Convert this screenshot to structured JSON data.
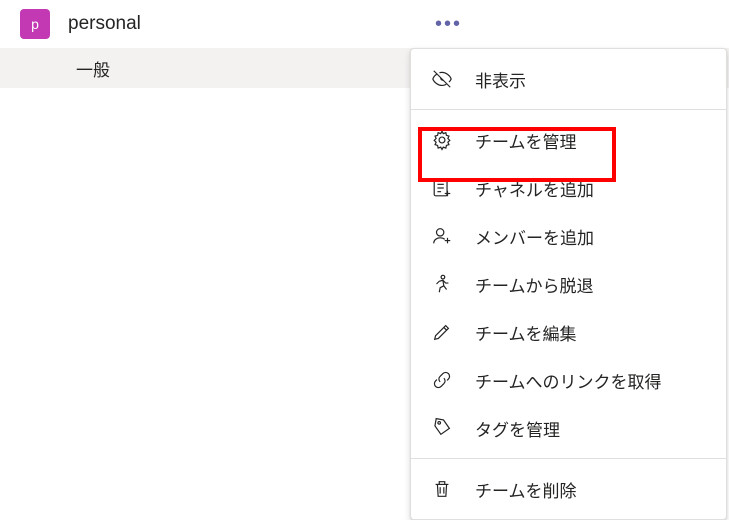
{
  "team": {
    "avatar_letter": "p",
    "name": "personal"
  },
  "channel": {
    "general": "一般"
  },
  "menu": {
    "hide": "非表示",
    "manage_team": "チームを管理",
    "add_channel": "チャネルを追加",
    "add_member": "メンバーを追加",
    "leave_team": "チームから脱退",
    "edit_team": "チームを編集",
    "get_link": "チームへのリンクを取得",
    "manage_tags": "タグを管理",
    "delete_team": "チームを削除"
  },
  "more_dots": "•••"
}
